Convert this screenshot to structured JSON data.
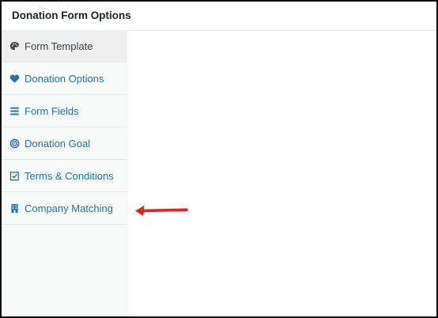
{
  "panel": {
    "title": "Donation Form Options"
  },
  "sidebar": {
    "items": [
      {
        "label": "Form Template",
        "icon": "palette-icon",
        "active": true
      },
      {
        "label": "Donation Options",
        "icon": "heart-icon"
      },
      {
        "label": "Form Fields",
        "icon": "list-icon"
      },
      {
        "label": "Donation Goal",
        "icon": "target-icon"
      },
      {
        "label": "Terms & Conditions",
        "icon": "checkbox-icon"
      },
      {
        "label": "Company Matching",
        "icon": "building-icon"
      }
    ]
  },
  "colors": {
    "link": "#2271b1",
    "active_text": "#3c434a",
    "annotation_arrow": "#e02424"
  }
}
